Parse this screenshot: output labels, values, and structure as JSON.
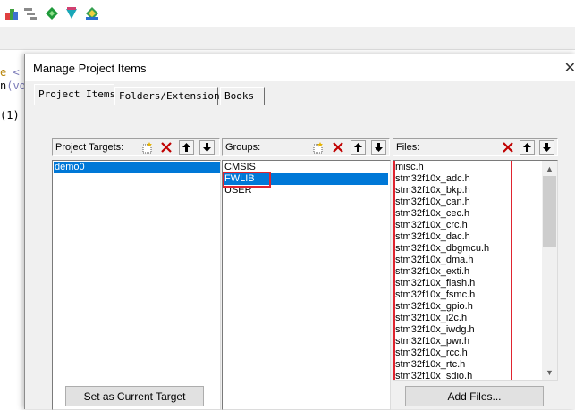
{
  "colors": {
    "selection": "#0078d7",
    "highlight": "#e0242f",
    "dialog_face": "#f0f0f0"
  },
  "ide": {
    "toolbar_icons": [
      "project-icon",
      "batch-icon",
      "diamond-green-icon",
      "diamond-teal-icon",
      "diamond-multi-icon"
    ],
    "code_lines": [
      {
        "left": "e",
        "mid": " <",
        "right": ""
      },
      {
        "left": "n",
        "mid": "(vo",
        "right": ""
      },
      {
        "left": "",
        "mid": "",
        "right": ""
      },
      {
        "left": "(1)",
        "mid": "",
        "right": ""
      }
    ]
  },
  "dialog": {
    "title": "Manage Project Items",
    "close_label": "✕",
    "tabs": [
      {
        "label": "Project Items",
        "active": true
      },
      {
        "label": "Folders/Extensions",
        "active": false
      },
      {
        "label": "Books",
        "active": false
      }
    ],
    "targets": {
      "label": "Project Targets:",
      "items": [
        {
          "label": "demo0",
          "selected": true
        }
      ]
    },
    "groups": {
      "label": "Groups:",
      "items": [
        {
          "label": "CMSIS",
          "selected": false
        },
        {
          "label": "FWLIB",
          "selected": true
        },
        {
          "label": "USER",
          "selected": false
        }
      ]
    },
    "files": {
      "label": "Files:",
      "items": [
        "misc.h",
        "stm32f10x_adc.h",
        "stm32f10x_bkp.h",
        "stm32f10x_can.h",
        "stm32f10x_cec.h",
        "stm32f10x_crc.h",
        "stm32f10x_dac.h",
        "stm32f10x_dbgmcu.h",
        "stm32f10x_dma.h",
        "stm32f10x_exti.h",
        "stm32f10x_flash.h",
        "stm32f10x_fsmc.h",
        "stm32f10x_gpio.h",
        "stm32f10x_i2c.h",
        "stm32f10x_iwdg.h",
        "stm32f10x_pwr.h",
        "stm32f10x_rcc.h",
        "stm32f10x_rtc.h",
        "stm32f10x_sdio.h"
      ],
      "scroll_up": "▲",
      "scroll_down": "▼"
    },
    "buttons": {
      "set_current_target": "Set as Current Target",
      "add_files": "Add Files..."
    }
  }
}
